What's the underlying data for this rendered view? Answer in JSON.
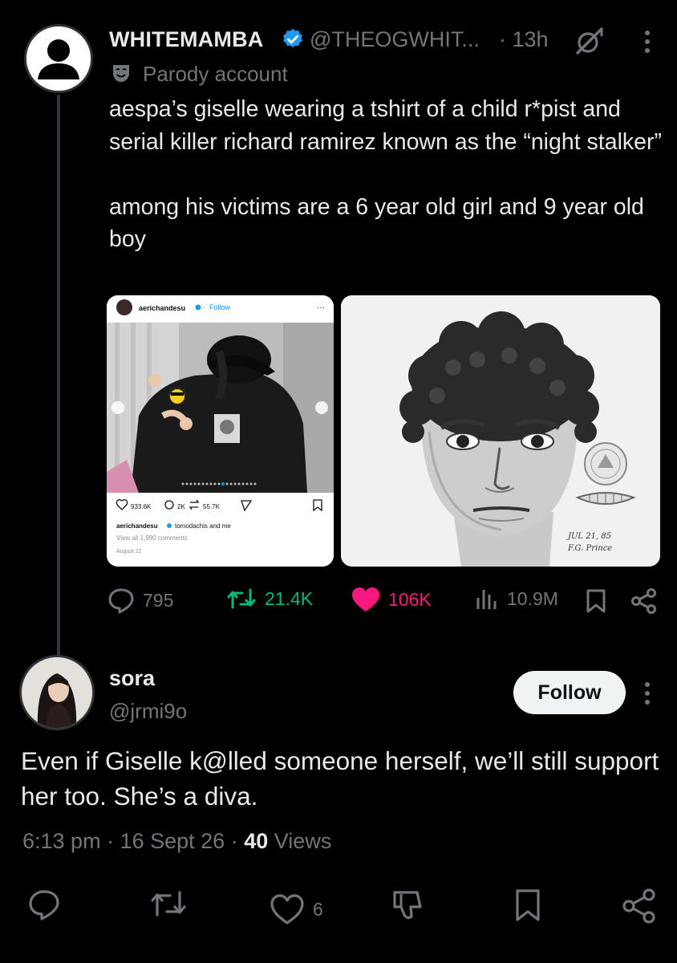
{
  "parent_tweet": {
    "display_name": "WHITEMAMBA",
    "handle": "@THEOGWHIT...",
    "time": "· 13h",
    "label": "Parody account",
    "text": "aespa’s giselle wearing a tshirt of a child r*pist and serial killer richard ramirez known as the “night stalker”\n\namong his victims are a 6 year old girl and 9 year old boy",
    "media_left": {
      "account": "aerichandesu",
      "follow": "Follow",
      "likes": "933.6K",
      "comments": "2K",
      "reposts": "55.7K",
      "caption_account": "aerichandesu",
      "caption": "tomodachis and me",
      "view_comments": "View all 1,990 comments",
      "date": "August 22"
    },
    "media_right": {
      "sketch_note": "JUL 21, 85\nF.G. Prince"
    },
    "stats": {
      "replies": "795",
      "reposts": "21.4K",
      "likes": "106K",
      "views": "10.9M"
    }
  },
  "reply_tweet": {
    "display_name": "sora",
    "handle": "@jrmi9o",
    "follow_label": "Follow",
    "text": "Even if Giselle k@lled someone herself, we’ll still support her too. She’s a diva.",
    "time": "6:13 pm",
    "date": "16 Sept 26",
    "views_count": "40",
    "views_label": "Views",
    "likes": "6"
  },
  "colors": {
    "background": "#000000",
    "text_primary": "#e7e9ea",
    "text_secondary": "#71767b",
    "verified_blue": "#1d9bf0",
    "repost_green": "#00ba7c",
    "like_pink": "#f91880"
  }
}
